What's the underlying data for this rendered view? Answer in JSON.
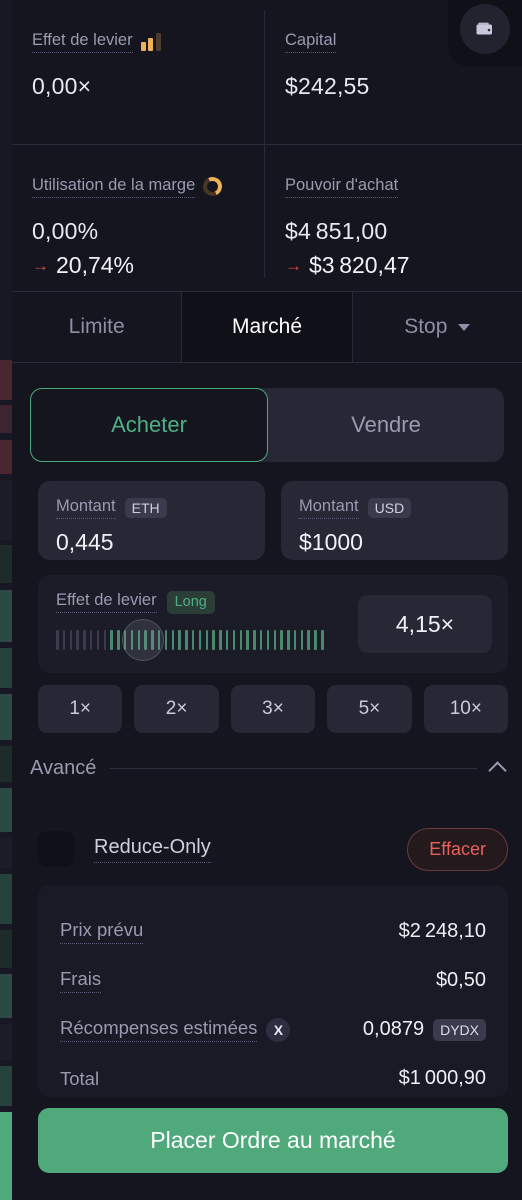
{
  "stats": [
    {
      "label": "Effet de levier",
      "icon": "bar-chart-icon",
      "value": "0,00×",
      "secondary": null
    },
    {
      "label": "Capital",
      "icon": null,
      "value": "$242,55",
      "secondary": null
    },
    {
      "label": "Utilisation de la marge",
      "icon": "donut-gauge-icon",
      "value": "0,00%",
      "secondary": "20,74%"
    },
    {
      "label": "Pouvoir d'achat",
      "icon": null,
      "value": "$4 851,00",
      "secondary": "$3 820,47"
    }
  ],
  "wallet_button": {
    "icon": "wallet-icon"
  },
  "order_type_tabs": [
    {
      "label": "Limite",
      "active": false,
      "has_caret": false
    },
    {
      "label": "Marché",
      "active": true,
      "has_caret": false
    },
    {
      "label": "Stop",
      "active": false,
      "has_caret": true
    }
  ],
  "side_toggle": {
    "buy_label": "Acheter",
    "sell_label": "Vendre",
    "selected": "Acheter"
  },
  "amount_inputs": [
    {
      "label": "Montant",
      "unit": "ETH",
      "value": "0,445"
    },
    {
      "label": "Montant",
      "unit": "USD",
      "value": "$1000"
    }
  ],
  "leverage": {
    "label": "Effet de levier",
    "direction_badge": "Long",
    "value": "4,15×",
    "slider": {
      "total_ticks": 40,
      "filled_from": 8,
      "thumb_position_pct": 21
    }
  },
  "leverage_presets": [
    "1×",
    "2×",
    "3×",
    "5×",
    "10×"
  ],
  "advanced": {
    "title": "Avancé",
    "expanded": true,
    "chevron": "chevron-up-icon",
    "reduce_only_label": "Reduce-Only",
    "reduce_only_checked": false,
    "clear_label": "Effacer"
  },
  "summary": [
    {
      "key": "Prix prévu",
      "value": "$2 248,10",
      "token": null,
      "badge": null,
      "dotted": true
    },
    {
      "key": "Frais",
      "value": "$0,50",
      "token": null,
      "badge": null,
      "dotted": true
    },
    {
      "key": "Récompenses estimées",
      "value": "0,0879",
      "token": "DYDX",
      "badge": "X",
      "dotted": true
    },
    {
      "key": "Total",
      "value": "$1 000,90",
      "token": null,
      "badge": null,
      "dotted": false
    }
  ],
  "submit_button": {
    "label": "Placer Ordre au marché"
  },
  "colors": {
    "accent_green": "#4fa97b",
    "negative_red": "#e04a3f",
    "amber": "#f0b05a",
    "panel_bg": "#15151f",
    "card_bg": "#272736"
  }
}
